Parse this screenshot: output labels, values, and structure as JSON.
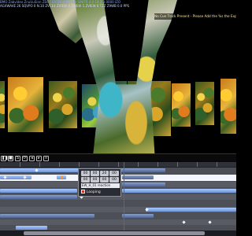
{
  "app": {
    "info_line1": "BMO Zabvideo  ZnuUuSinn ZE6   CENTER HAROLD SINITR   0.0  19.2  3.0000  IZO",
    "info_line2": "AGXWAVE 26    SQVPO   0  N.10  ZVCE4  ZVIEW 4 ZVIEW 5 ZVIEW 6  TZZ  Z9WB   0.0  PPS",
    "notification": "No Cue Track Present - Please Add the %s the Exp"
  },
  "transport": {
    "buttons": [
      {
        "name": "pause-button",
        "glyph": "❚❚"
      },
      {
        "name": "stop-button",
        "glyph": "■"
      },
      {
        "name": "record-button",
        "glyph": "S"
      },
      {
        "name": "loop-button",
        "glyph": "⟳"
      },
      {
        "name": "prev-button",
        "glyph": "◂"
      },
      {
        "name": "next-button",
        "glyph": "▸"
      },
      {
        "name": "link-button",
        "glyph": "∞"
      }
    ]
  },
  "popup": {
    "row1": [
      "00",
      "00",
      "20",
      "00"
    ],
    "row2": [
      "00",
      "00",
      "00",
      "00"
    ],
    "name": "EW_H_01 reaction",
    "loop_label": "Looping"
  },
  "colors": {
    "accent_clip": "#6d93d6",
    "playhead": "#d23a3a",
    "notification_text": "#ffe38a"
  }
}
